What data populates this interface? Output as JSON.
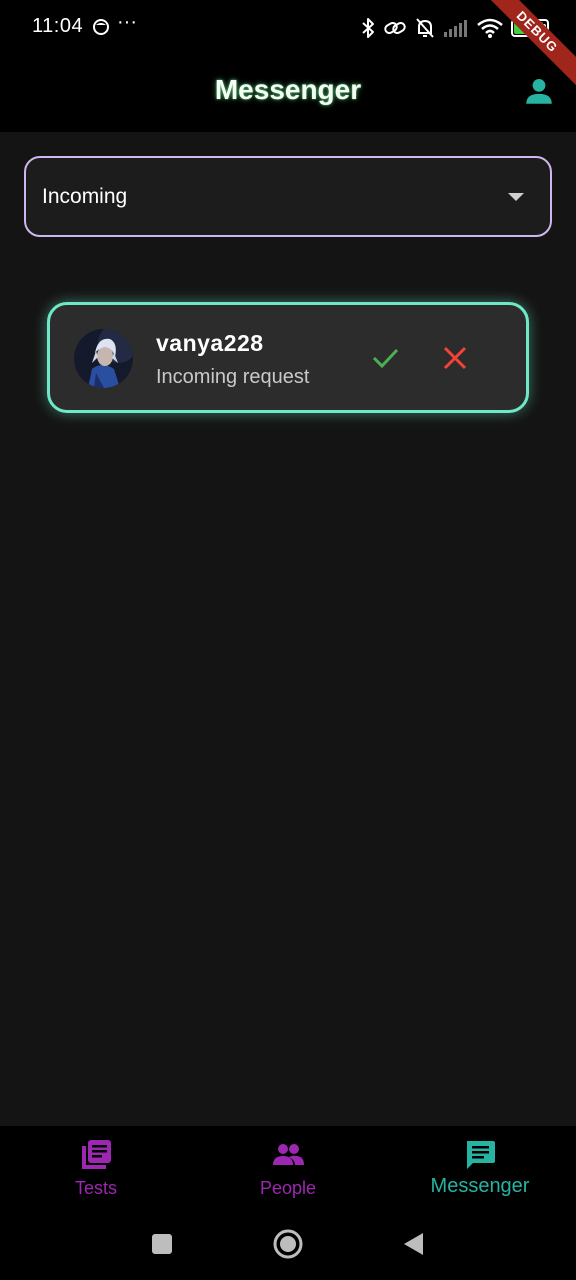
{
  "status_bar": {
    "time": "11:04",
    "dots": "···",
    "battery_percent": "92",
    "battery_level": 0.92
  },
  "debug_ribbon": "DEBUG",
  "app_bar": {
    "title": "Messenger",
    "profile_icon": "person-icon"
  },
  "filter": {
    "selected": "Incoming"
  },
  "requests": [
    {
      "username": "vanya228",
      "status": "Incoming request",
      "accept_icon": "check-icon",
      "decline_icon": "close-icon"
    }
  ],
  "bottom_nav": {
    "items": [
      {
        "label": "Tests",
        "icon": "article-icon",
        "active": false
      },
      {
        "label": "People",
        "icon": "people-icon",
        "active": false
      },
      {
        "label": "Messenger",
        "icon": "chat-icon",
        "active": true
      }
    ]
  },
  "colors": {
    "accent_teal": "#27b3a2",
    "inactive_purple": "#9c27b0",
    "card_border": "#6fe8c8",
    "dropdown_border": "#cfb6ee",
    "accept_green": "#4caf50",
    "decline_red": "#f44336"
  }
}
